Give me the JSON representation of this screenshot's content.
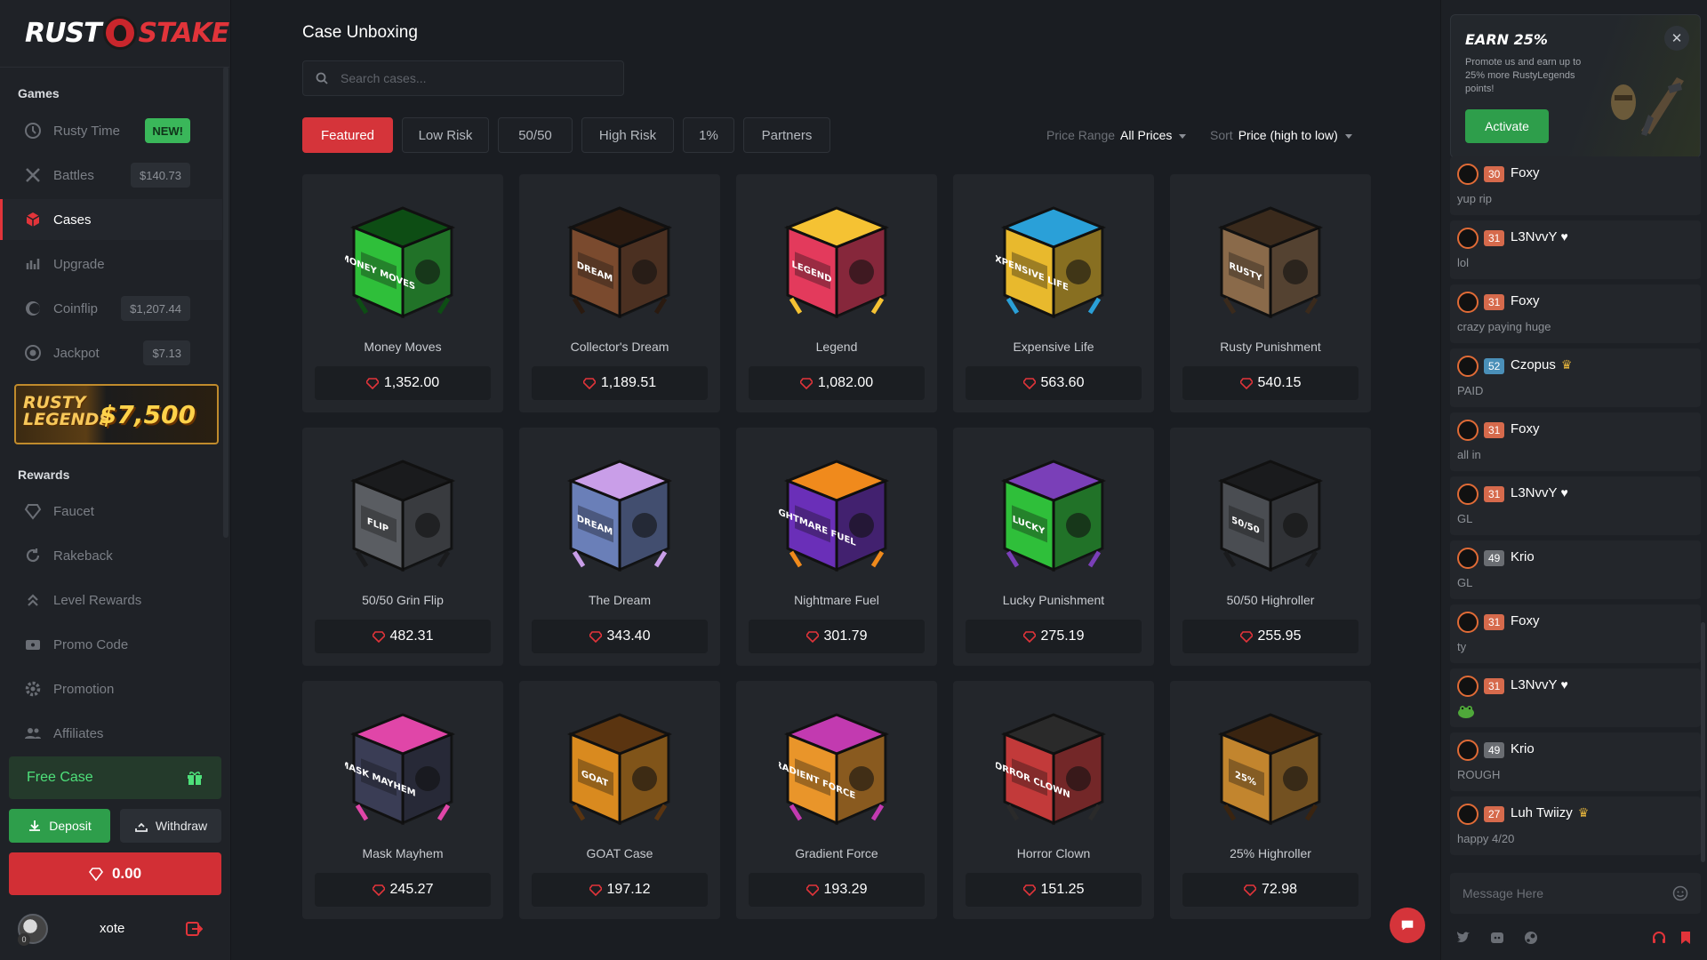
{
  "logo": {
    "left": "RUST",
    "right": "STAKE"
  },
  "sidebar": {
    "games_title": "Games",
    "games": [
      {
        "label": "Rusty Time",
        "tag": "NEW!",
        "icon": "clock-icon"
      },
      {
        "label": "Battles",
        "tag": "$140.73",
        "icon": "swords-icon"
      },
      {
        "label": "Cases",
        "tag": "",
        "icon": "box-icon"
      },
      {
        "label": "Upgrade",
        "tag": "",
        "icon": "upgrade-icon"
      },
      {
        "label": "Coinflip",
        "tag": "$1,207.44",
        "icon": "coin-icon"
      },
      {
        "label": "Jackpot",
        "tag": "$7.13",
        "icon": "target-icon"
      }
    ],
    "promo_banner": {
      "left_text": "RUSTY LEGENDS",
      "right_text": "$7,500"
    },
    "rewards_title": "Rewards",
    "rewards": [
      {
        "label": "Faucet",
        "icon": "diamond-icon"
      },
      {
        "label": "Rakeback",
        "icon": "refresh-icon"
      },
      {
        "label": "Level Rewards",
        "icon": "chevrons-up-icon"
      },
      {
        "label": "Promo Code",
        "icon": "ticket-icon"
      },
      {
        "label": "Promotion",
        "icon": "gear-icon"
      },
      {
        "label": "Affiliates",
        "icon": "users-icon"
      }
    ],
    "free_case": "Free Case",
    "deposit": "Deposit",
    "withdraw": "Withdraw",
    "balance": "0.00",
    "user": {
      "name": "xote",
      "level": "0"
    }
  },
  "main": {
    "title": "Case Unboxing",
    "search_placeholder": "Search cases...",
    "filters": [
      "Featured",
      "Low Risk",
      "50/50",
      "High Risk",
      "1%",
      "Partners"
    ],
    "active_filter": "Featured",
    "price_range_label": "Price Range",
    "price_range_value": "All Prices",
    "sort_label": "Sort",
    "sort_value": "Price (high to low)",
    "cases": [
      {
        "name": "Money Moves",
        "price": "1,352.00",
        "color": "#2fbf3a",
        "accent": "#0d4d14",
        "label": "MONEY MOVES"
      },
      {
        "name": "Collector's Dream",
        "price": "1,189.51",
        "color": "#7a4a2e",
        "accent": "#2a1a10",
        "label": "DREAM"
      },
      {
        "name": "Legend",
        "price": "1,082.00",
        "color": "#e33a5c",
        "accent": "#f5c233",
        "label": "LEGEND"
      },
      {
        "name": "Expensive Life",
        "price": "563.60",
        "color": "#e8b92d",
        "accent": "#2aa0d8",
        "label": "EXPENSIVE LIFE"
      },
      {
        "name": "Rusty Punishment",
        "price": "540.15",
        "color": "#8a6a4a",
        "accent": "#3a2a1c",
        "label": "RUSTY"
      },
      {
        "name": "50/50 Grin Flip",
        "price": "482.31",
        "color": "#5a5d62",
        "accent": "#1a1b1d",
        "label": "FLIP"
      },
      {
        "name": "The Dream",
        "price": "343.40",
        "color": "#6a7fb8",
        "accent": "#c99ee8",
        "label": "DREAM"
      },
      {
        "name": "Nightmare Fuel",
        "price": "301.79",
        "color": "#6a2fb8",
        "accent": "#f08a1c",
        "label": "NIGHTMARE FUEL"
      },
      {
        "name": "Lucky Punishment",
        "price": "275.19",
        "color": "#2fbf3a",
        "accent": "#7a3fb8",
        "label": "LUCKY"
      },
      {
        "name": "50/50 Highroller",
        "price": "255.95",
        "color": "#4a4d52",
        "accent": "#1a1b1d",
        "label": "50/50"
      },
      {
        "name": "Mask Mayhem",
        "price": "245.27",
        "color": "#3a3d55",
        "accent": "#e046a8",
        "label": "MASK MAYHEM"
      },
      {
        "name": "GOAT Case",
        "price": "197.12",
        "color": "#d98a1f",
        "accent": "#5a3410",
        "label": "GOAT"
      },
      {
        "name": "Gradient Force",
        "price": "193.29",
        "color": "#e9952a",
        "accent": "#c23ab0",
        "label": "GRADIENT FORCE"
      },
      {
        "name": "Horror Clown",
        "price": "151.25",
        "color": "#c23a3a",
        "accent": "#2a2a2a",
        "label": "HORROR CLOWN"
      },
      {
        "name": "25% Highroller",
        "price": "72.98",
        "color": "#c2852e",
        "accent": "#3a2410",
        "label": "25%"
      }
    ]
  },
  "chat": {
    "earn": {
      "title": "EARN 25%",
      "desc": "Promote us and earn up to 25% more RustyLegends points!",
      "button": "Activate"
    },
    "messages": [
      {
        "level": "30",
        "name": "Foxy",
        "text": "yup rip",
        "badge": "",
        "lvl_color": "#d66a4c"
      },
      {
        "level": "31",
        "name": "L3NvvY",
        "text": "lol",
        "badge": "heart",
        "lvl_color": "#d66a4c"
      },
      {
        "level": "31",
        "name": "Foxy",
        "text": "crazy paying huge",
        "badge": "",
        "lvl_color": "#d66a4c"
      },
      {
        "level": "52",
        "name": "Czopus",
        "text": "PAID",
        "badge": "crown",
        "lvl_color": "#4a8fb8"
      },
      {
        "level": "31",
        "name": "Foxy",
        "text": "all in",
        "badge": "",
        "lvl_color": "#d66a4c"
      },
      {
        "level": "31",
        "name": "L3NvvY",
        "text": "GL",
        "badge": "heart",
        "lvl_color": "#d66a4c"
      },
      {
        "level": "49",
        "name": "Krio",
        "text": "GL",
        "badge": "",
        "lvl_color": "#6a6d72"
      },
      {
        "level": "31",
        "name": "Foxy",
        "text": "ty",
        "badge": "",
        "lvl_color": "#d66a4c"
      },
      {
        "level": "31",
        "name": "L3NvvY",
        "text": "",
        "badge": "heart",
        "lvl_color": "#d66a4c",
        "emote": "frog-emote"
      },
      {
        "level": "49",
        "name": "Krio",
        "text": "ROUGH",
        "badge": "",
        "lvl_color": "#6a6d72"
      },
      {
        "level": "27",
        "name": "Luh Twiizy",
        "text": "happy 4/20",
        "badge": "crown",
        "lvl_color": "#d66a4c"
      }
    ],
    "input_placeholder": "Message Here"
  },
  "colors": {
    "accent": "#d5343a",
    "green": "#2e9e4b",
    "bg": "#1a1d22",
    "card": "#23262b"
  }
}
